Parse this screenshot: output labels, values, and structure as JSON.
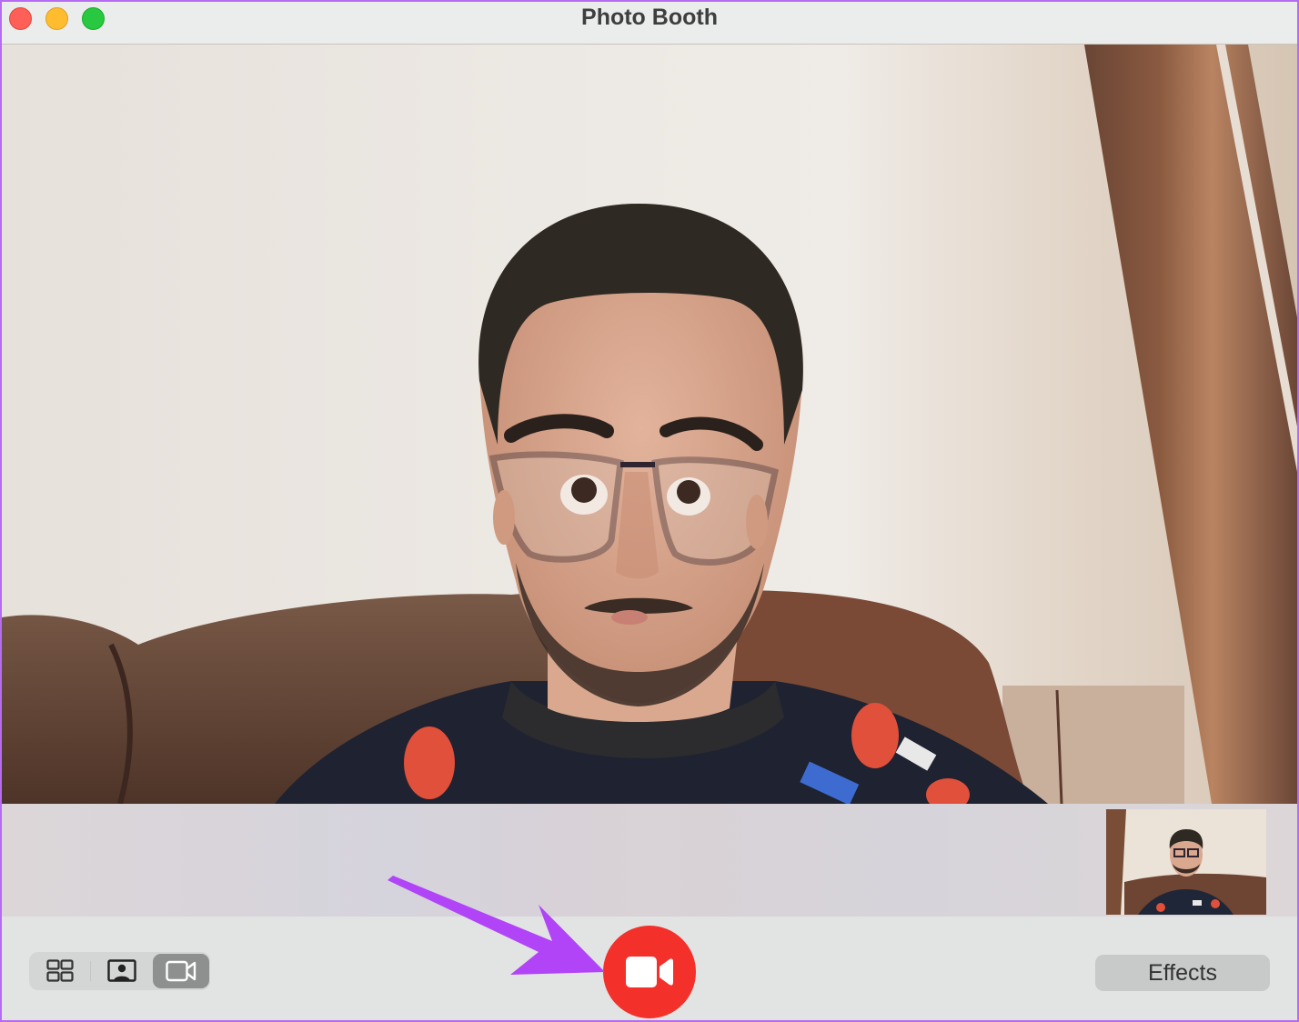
{
  "window": {
    "title": "Photo Booth",
    "traffic_lights": [
      {
        "name": "close",
        "color": "#fe5f57"
      },
      {
        "name": "minimize",
        "color": "#febc2e"
      },
      {
        "name": "maximize",
        "color": "#28c840"
      }
    ]
  },
  "preview": {
    "description": "Live camera preview with distortion effect: man with glasses and beard seated on brown leather sofa",
    "effect_active": true
  },
  "strip": {
    "thumbnails": [
      {
        "description": "Captured thumbnail of man with glasses on sofa"
      }
    ]
  },
  "toolbar": {
    "mode_buttons": [
      {
        "id": "grid",
        "icon": "four-up-grid-icon",
        "selected": false
      },
      {
        "id": "photo",
        "icon": "single-photo-icon",
        "selected": false
      },
      {
        "id": "video",
        "icon": "video-camera-icon",
        "selected": true
      }
    ],
    "record_button": {
      "icon": "video-camera-icon",
      "color": "#f3302a"
    },
    "effects_label": "Effects"
  },
  "annotation": {
    "type": "arrow",
    "color": "#b044f6",
    "points_to": "record_button"
  },
  "colors": {
    "accent_record": "#f3302a",
    "annotation_purple": "#b044f6",
    "selected_segment": "#8e8f8f"
  }
}
